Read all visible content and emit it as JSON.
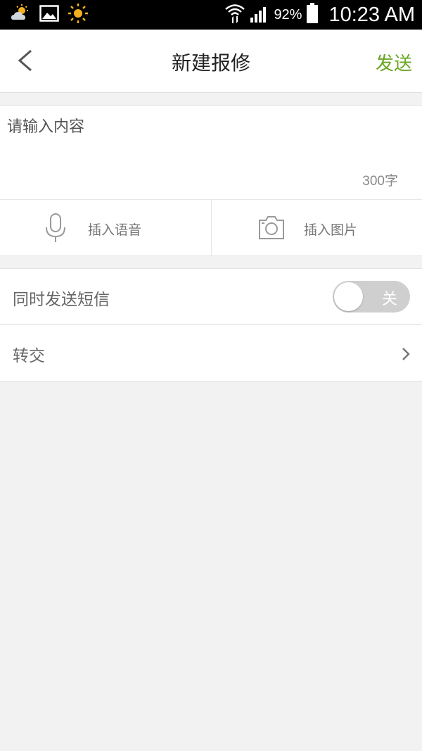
{
  "status_bar": {
    "battery_percent": "92%",
    "time": "10:23 AM",
    "icons": [
      "weather-partly-sunny-icon",
      "gallery-icon",
      "sun-icon",
      "wifi-icon",
      "signal-icon",
      "battery-icon"
    ]
  },
  "header": {
    "title": "新建报修",
    "send_label": "发送",
    "back_icon": "chevron-left-icon"
  },
  "form": {
    "content_placeholder": "请输入内容",
    "content_value": "",
    "char_limit": "300字",
    "insert_voice_label": "插入语音",
    "insert_image_label": "插入图片"
  },
  "settings": {
    "sms_label": "同时发送短信",
    "sms_toggle_text": "关",
    "sms_enabled": false,
    "forward_label": "转交"
  },
  "colors": {
    "accent_green": "#6aa623",
    "background": "#f2f2f2",
    "toggle_off": "#cfcfcf"
  }
}
